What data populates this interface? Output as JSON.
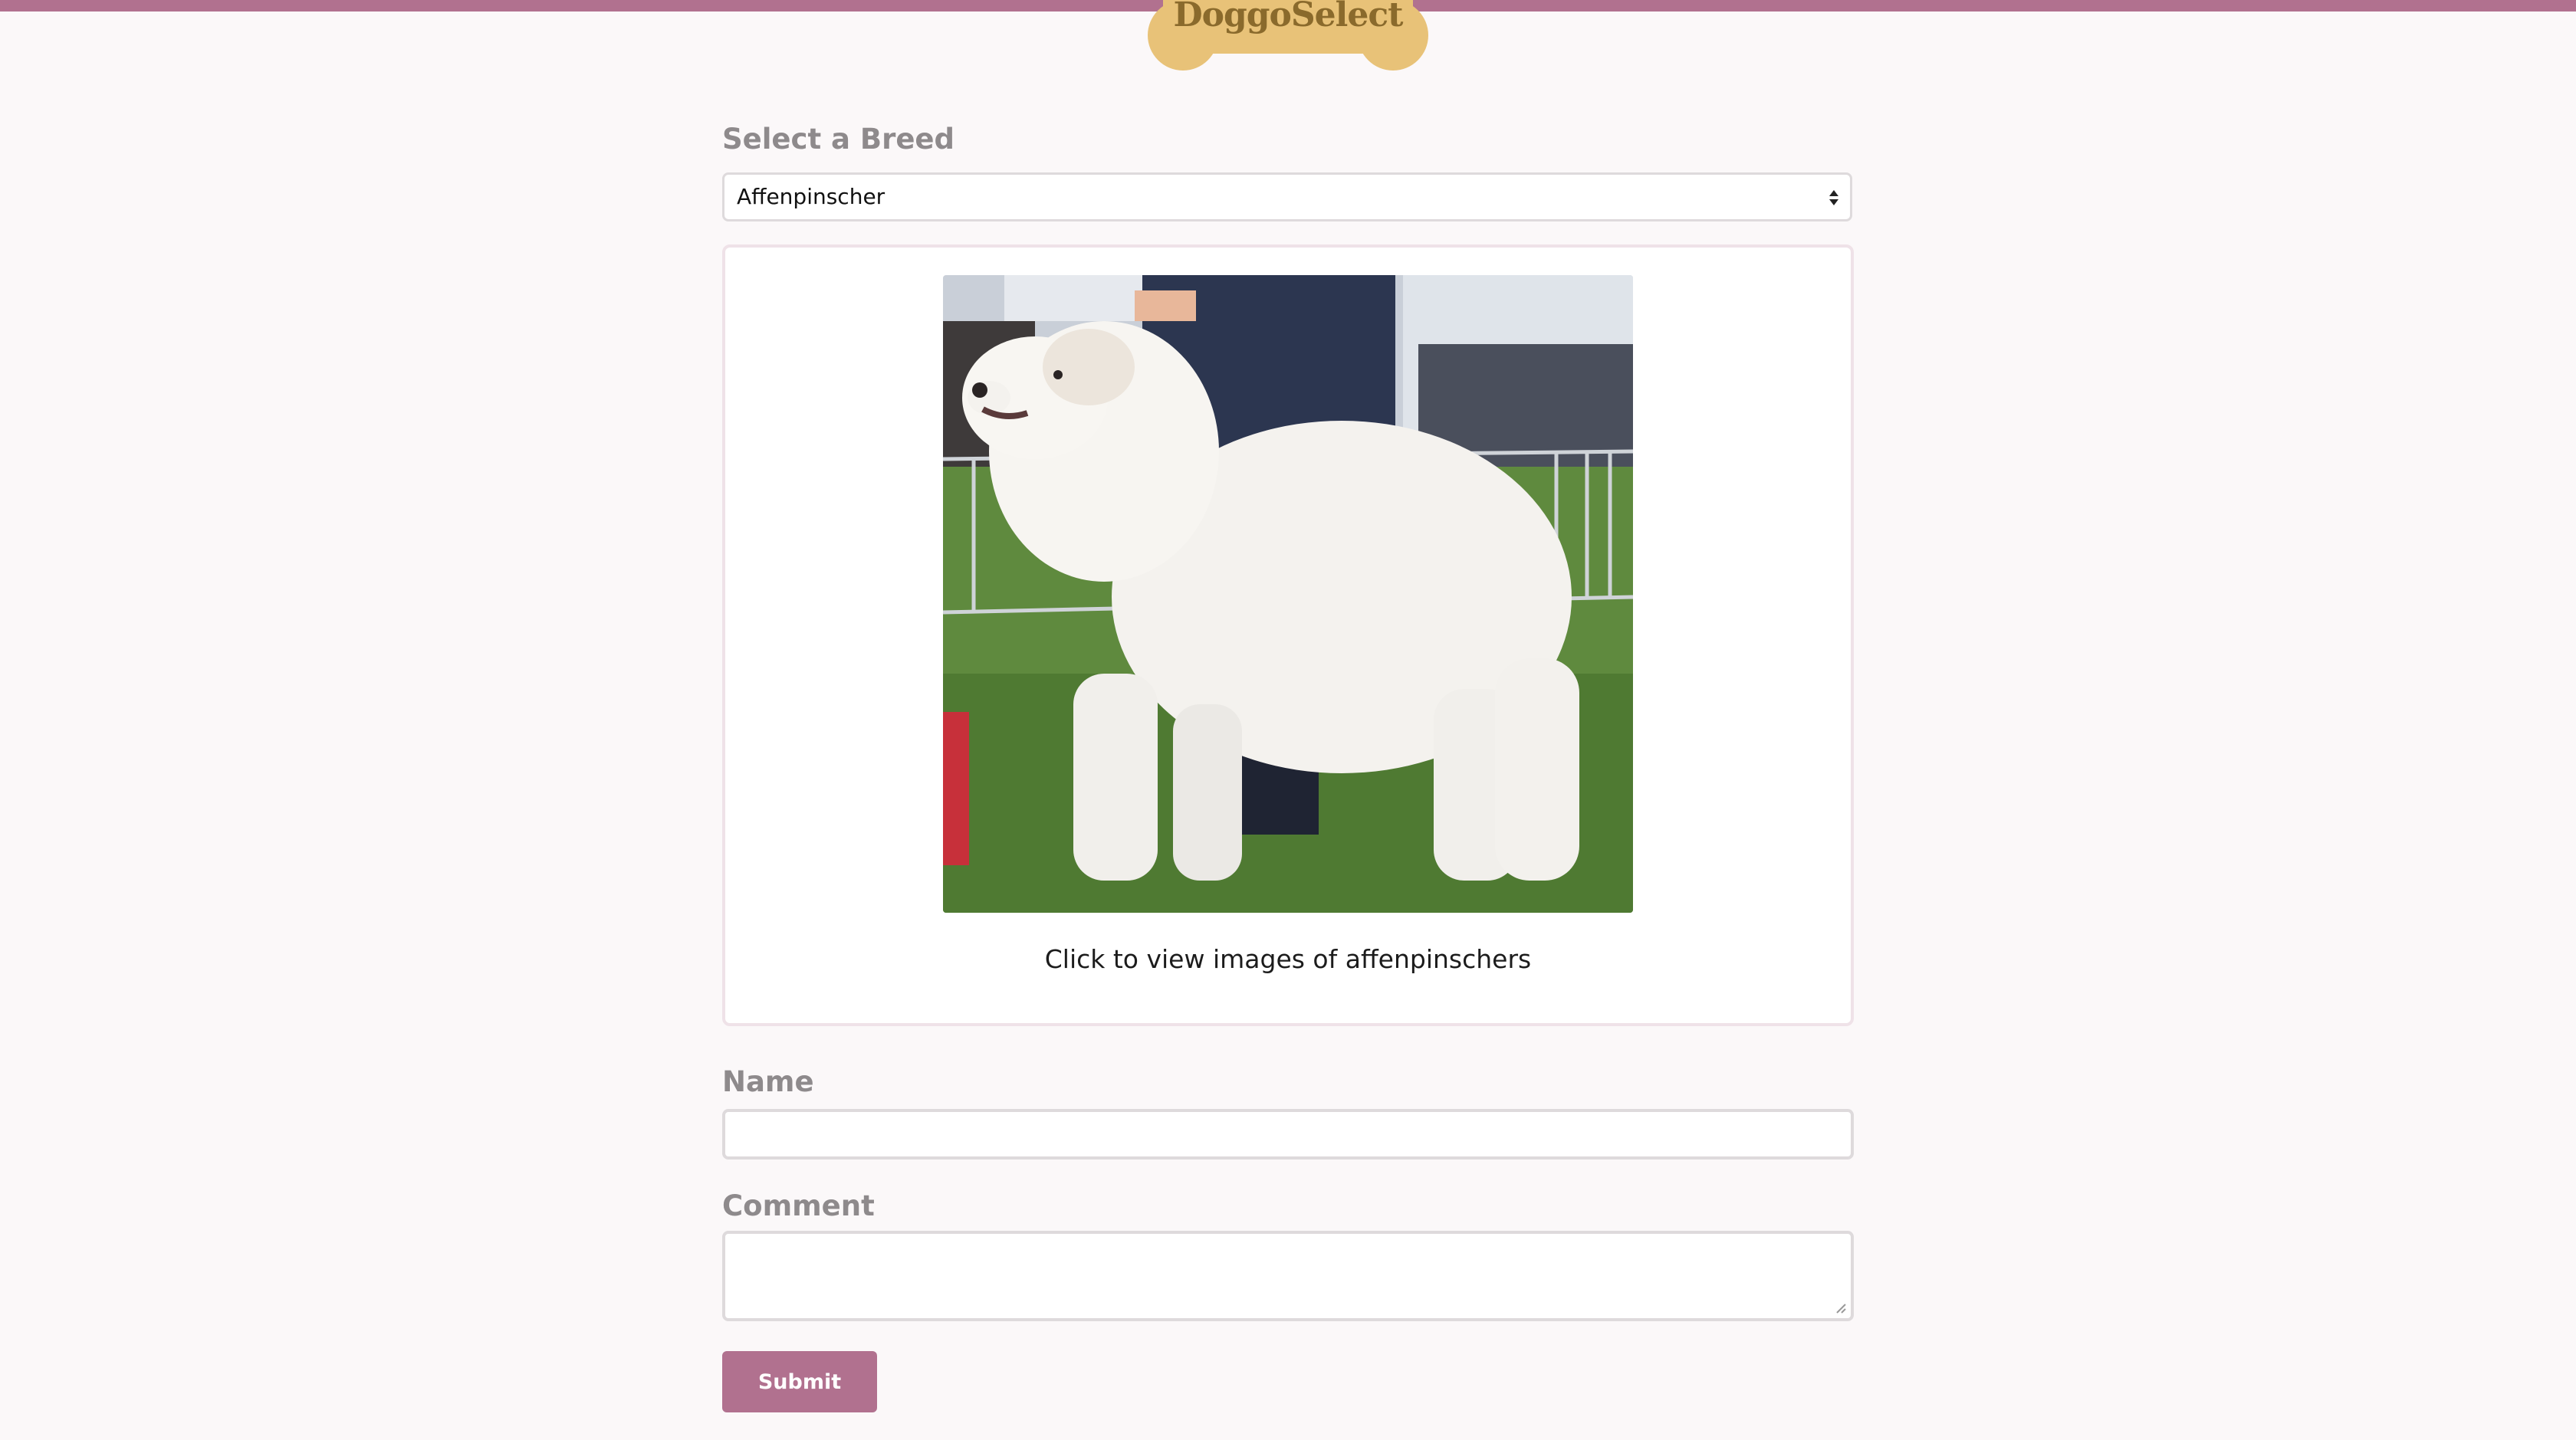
{
  "app": {
    "brand": "DoggoSelect",
    "accent_color": "#b1718f",
    "logo_color": "#e8c278"
  },
  "breed": {
    "label": "Select a Breed",
    "selected": "Affenpinscher"
  },
  "preview": {
    "image_icon": "dog-photo",
    "caption": "Click to view images of affenpinschers"
  },
  "form": {
    "name_label": "Name",
    "name_value": "",
    "comment_label": "Comment",
    "comment_value": "",
    "submit_label": "Submit"
  }
}
